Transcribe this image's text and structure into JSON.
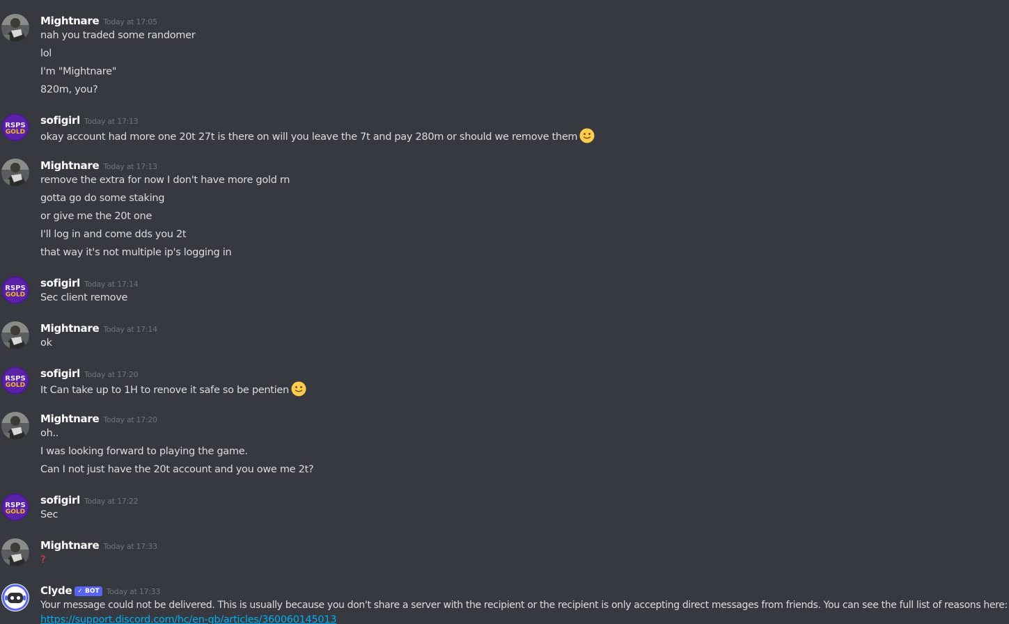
{
  "messages": [
    {
      "username": "Mightnare",
      "timestamp": "Today at 17:05",
      "lines": [
        "nah you traded some randomer",
        "lol",
        "I'm \"Mightnare\"",
        "820m, you?"
      ]
    },
    {
      "username": "sofigirl",
      "timestamp": "Today at 17:13",
      "lines": [
        "okay account had more one 20t 27t is there on will you leave the 7t and pay 280m or should we remove them"
      ]
    },
    {
      "username": "Mightnare",
      "timestamp": "Today at 17:13",
      "lines": [
        "remove the extra for now I don't have more gold rn",
        "gotta go do some staking",
        "or give me the 20t one",
        "I'll log in and come dds you 2t",
        "that way it's not multiple ip's logging in"
      ]
    },
    {
      "username": "sofigirl",
      "timestamp": "Today at 17:14",
      "lines": [
        "Sec client remove"
      ]
    },
    {
      "username": "Mightnare",
      "timestamp": "Today at 17:14",
      "lines": [
        "ok"
      ]
    },
    {
      "username": "sofigirl",
      "timestamp": "Today at 17:20",
      "lines": [
        "It Can take up to 1H to renove it safe so be pentien"
      ]
    },
    {
      "username": "Mightnare",
      "timestamp": "Today at 17:20",
      "lines": [
        "oh..",
        "I was looking forward to playing the game.",
        "Can I not just have the 20t account and you owe me 2t?"
      ]
    },
    {
      "username": "sofigirl",
      "timestamp": "Today at 17:22",
      "lines": [
        "Sec"
      ]
    },
    {
      "username": "Mightnare",
      "timestamp": "Today at 17:33",
      "lines": [
        "?"
      ]
    },
    {
      "username": "Clyde",
      "bot_tag": "✓ BOT",
      "timestamp": "Today at 17:33",
      "lines": [
        "Your message could not be delivered. This is usually because you don't share a server with the recipient or the recipient is only accepting direct messages from friends. You can see the full list of reasons here:"
      ],
      "link": "https://support.discord.com/hc/en-gb/articles/360060145013"
    }
  ],
  "avatar_text": {
    "sofigirl_top": "RSPS",
    "sofigirl_bottom": "GOLD"
  },
  "colors": {
    "background": "#36393f",
    "username": "#ffffff",
    "timestamp": "#72767d",
    "message_text": "#dcddde",
    "link": "#00aff4",
    "bot_tag": "#5865f2",
    "question_mark": "#ed4245",
    "sofigirl_avatar": "#4b1a8c",
    "clyde_avatar": "#5865f2"
  },
  "icons": {
    "mightnare_avatar": "photo-avatar",
    "sofigirl_avatar": "rsps-gold-logo-avatar",
    "clyde_avatar": "clyde-bot-avatar",
    "emoji": "slightly-smiling-face-emoji"
  }
}
